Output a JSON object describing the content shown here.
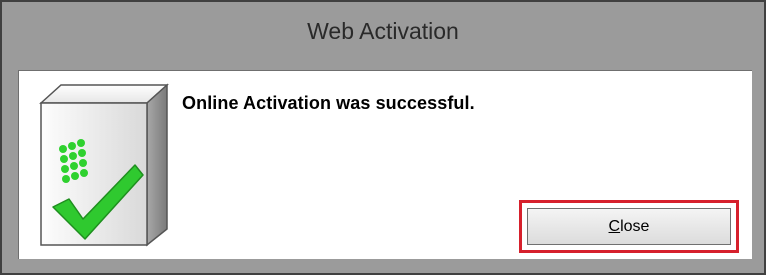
{
  "window": {
    "title": "Web Activation"
  },
  "dialog": {
    "message": "Online Activation was successful.",
    "close_button": {
      "mnemonic": "C",
      "rest": "lose"
    },
    "icon": "activation-checkmark-box-icon"
  },
  "colors": {
    "titlebar_bg": "#9b9b9b",
    "highlight_border": "#d6202c",
    "icon_dots": "#2fd12f",
    "checkmark": "#2fc92f"
  }
}
